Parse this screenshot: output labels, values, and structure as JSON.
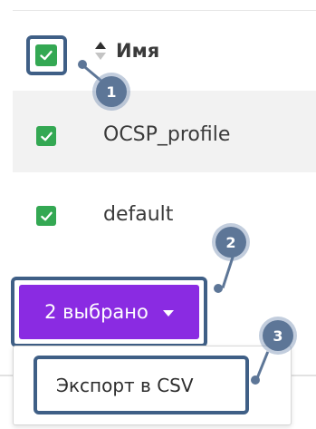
{
  "header": {
    "name_label": "Имя"
  },
  "rows": [
    {
      "name": "OCSP_profile",
      "checked": true
    },
    {
      "name": "default",
      "checked": true
    }
  ],
  "selection": {
    "label": "2 выбрано"
  },
  "menu": {
    "export_label": "Экспорт в CSV"
  },
  "callouts": [
    "1",
    "2",
    "3"
  ],
  "colors": {
    "checkbox": "#34a853",
    "primary_button": "#8a2be2",
    "callout": "#5d7697",
    "highlight_frame": "#3f5f86"
  },
  "icons": [
    "check-icon",
    "sort-icon",
    "chevron-down-icon"
  ]
}
